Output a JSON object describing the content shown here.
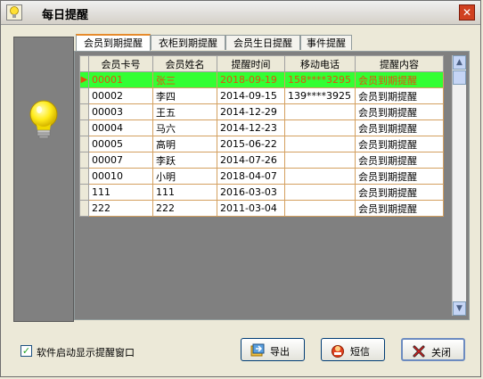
{
  "window": {
    "title": "每日提醒",
    "close_label": "✕"
  },
  "tabs": [
    {
      "label": "会员到期提醒",
      "active": true
    },
    {
      "label": "衣柜到期提醒",
      "active": false
    },
    {
      "label": "会员生日提醒",
      "active": false
    },
    {
      "label": "事件提醒",
      "active": false
    }
  ],
  "table": {
    "columns": [
      "会员卡号",
      "会员姓名",
      "提醒时间",
      "移动电话",
      "提醒内容"
    ],
    "rows": [
      [
        "00001",
        "张三",
        "2018-09-19",
        "158****3295",
        "会员到期提醒"
      ],
      [
        "00002",
        "李四",
        "2014-09-15",
        "139****3925",
        "会员到期提醒"
      ],
      [
        "00003",
        "王五",
        "2014-12-29",
        "",
        "会员到期提醒"
      ],
      [
        "00004",
        "马六",
        "2014-12-23",
        "",
        "会员到期提醒"
      ],
      [
        "00005",
        "高明",
        "2015-06-22",
        "",
        "会员到期提醒"
      ],
      [
        "00007",
        "李跃",
        "2014-07-26",
        "",
        "会员到期提醒"
      ],
      [
        "00010",
        "小明",
        "2018-04-07",
        "",
        "会员到期提醒"
      ],
      [
        "111",
        "111",
        "2016-03-03",
        "",
        "会员到期提醒"
      ],
      [
        "222",
        "222",
        "2011-03-04",
        "",
        "会员到期提醒"
      ]
    ],
    "selected_index": 0,
    "row_indicator": "▶"
  },
  "footer": {
    "startup_checkbox_label": "软件启动显示提醒窗口",
    "startup_checked": true,
    "export_label": "导出",
    "sms_label": "短信",
    "close_label": "关闭"
  },
  "colors": {
    "selected_row_bg": "#33FF33",
    "selected_row_text": "#E05010",
    "grid_border": "#D4A060",
    "active_tab_accent": "#E68B2C"
  },
  "icons": {
    "title": "lightbulb-icon",
    "sidebar": "lightbulb-icon",
    "export": "export-icon",
    "sms": "sms-icon",
    "close": "close-x-icon"
  }
}
